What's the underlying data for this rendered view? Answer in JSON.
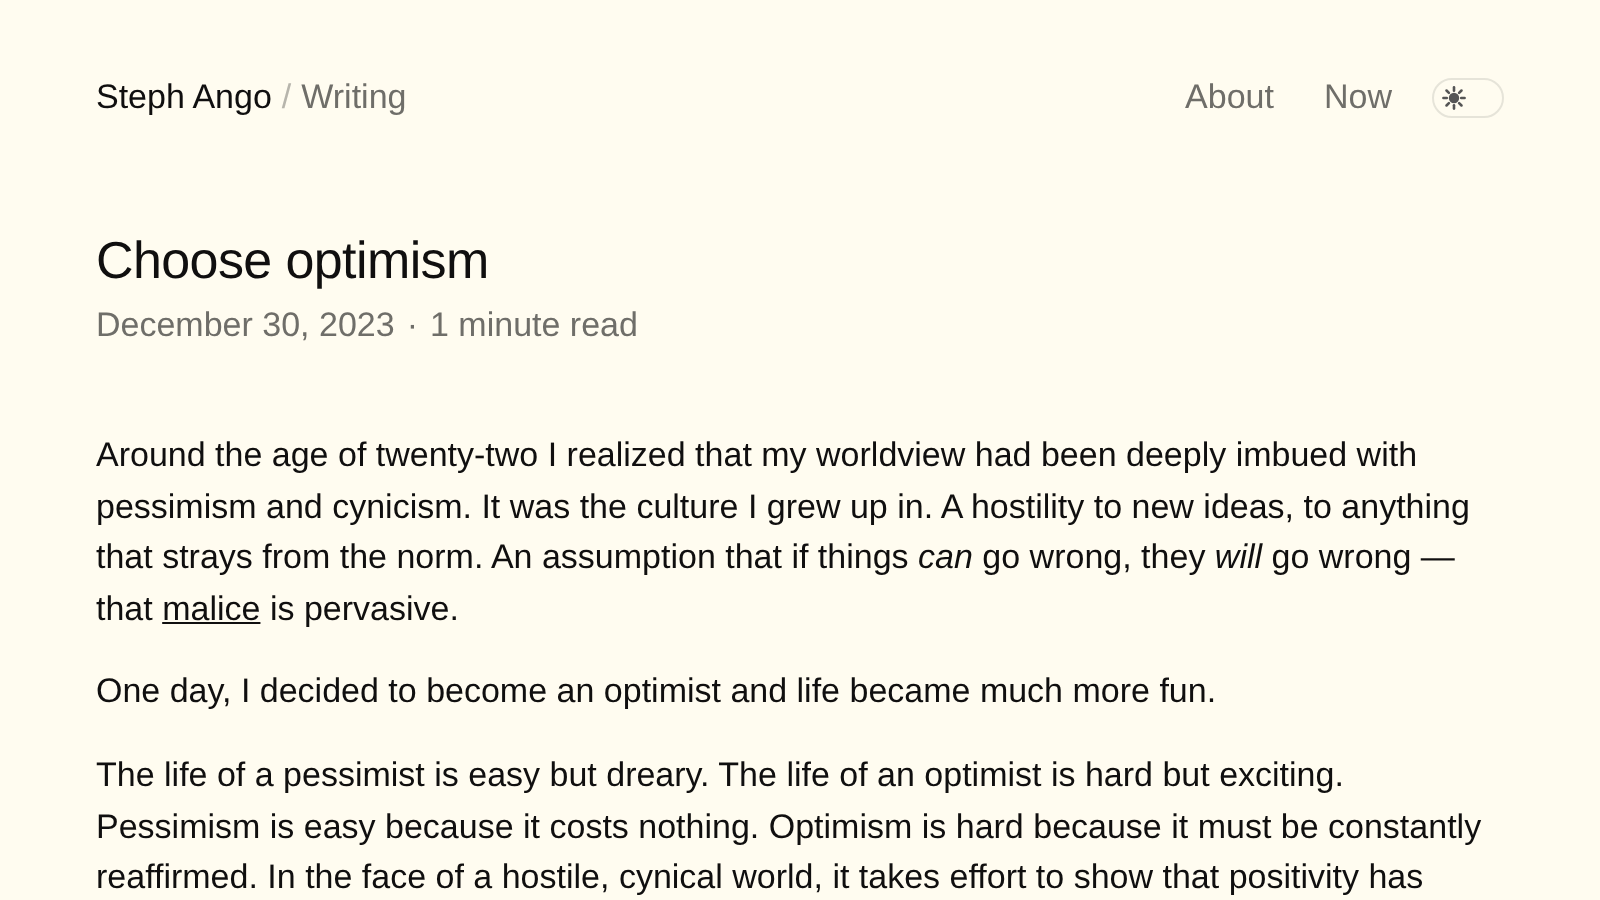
{
  "header": {
    "site_name": "Steph Ango",
    "separator": "/",
    "section": "Writing",
    "nav": [
      {
        "label": "About"
      },
      {
        "label": "Now"
      }
    ],
    "theme_toggle": {
      "on": false
    }
  },
  "article": {
    "title": "Choose optimism",
    "date": "December 30, 2023",
    "dot": "·",
    "read_time": "1 minute read",
    "paragraphs": [
      {
        "text": "Around the age of twenty-two I realized that my worldview had been deeply imbued with pessimism and cynicism. It was the culture I grew up in. A hostility to new ideas, to anything that strays from the norm. An assumption that if things *can* go wrong, they *will* go wrong — that ",
        "link": "malice",
        "after": " is pervasive."
      },
      {
        "text": "One day, I decided to become an optimist and life became much more fun."
      },
      {
        "text": "The life of a pessimist is easy but dreary. The life of an optimist is hard but exciting. Pessimism is easy because it costs nothing. Optimism is hard because it must be constantly reaffirmed. In the face of a hostile, cynical world, it takes effort to show that positivity has"
      }
    ]
  }
}
